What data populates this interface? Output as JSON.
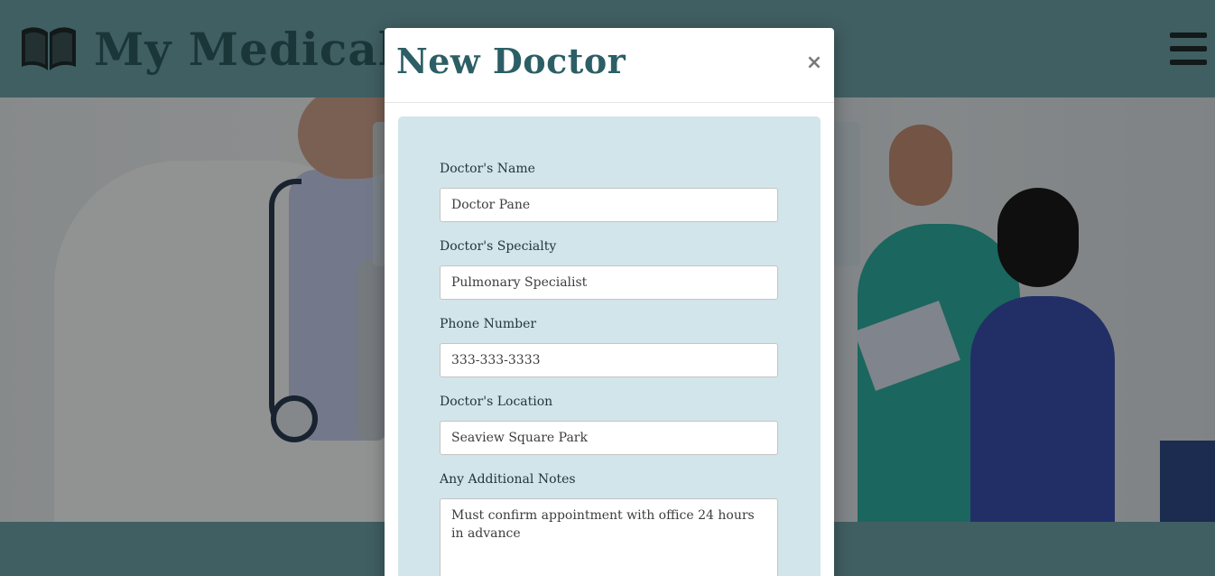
{
  "navbar": {
    "brand_text": "My Medical",
    "brand_icon": "book-icon",
    "menu_icon": "hamburger-menu-icon"
  },
  "modal": {
    "title": "New Doctor",
    "close_label": "×",
    "fields": [
      {
        "label": "Doctor's Name",
        "value": "Doctor Pane"
      },
      {
        "label": "Doctor's Specialty",
        "value": "Pulmonary Specialist"
      },
      {
        "label": "Phone Number",
        "value": "333-333-3333"
      },
      {
        "label": "Doctor's Location",
        "value": "Seaview Square Park"
      },
      {
        "label": "Any Additional Notes",
        "value": "Must confirm appointment with office 24 hours in advance"
      }
    ]
  },
  "colors": {
    "navbar": "#6fa4ab",
    "brand_text": "#2f5e63",
    "form_panel": "#d2e5ea",
    "modal_title": "#2c5f65"
  }
}
